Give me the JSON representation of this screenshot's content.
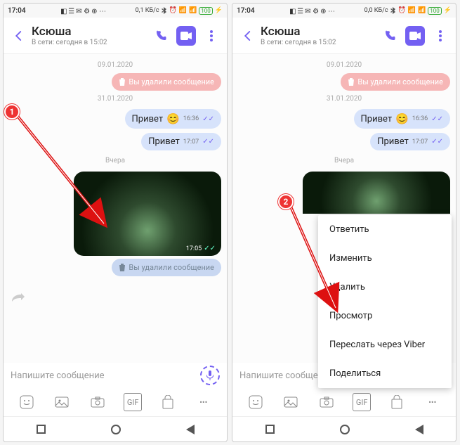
{
  "step1": {
    "badge": "1"
  },
  "step2": {
    "badge": "2"
  },
  "status": {
    "time": "17:04",
    "time2": "17:04",
    "net1": "0,1 КБ/с",
    "net2": "0,0 КБ/с",
    "battery": "100"
  },
  "header": {
    "title": "Ксюша",
    "subtitle": "В сети: сегодня в 15:02"
  },
  "dates": {
    "d1": "09.01.2020",
    "d2": "31.01.2020",
    "d3": "Вчера"
  },
  "messages": {
    "deleted": "Вы удалили сообщение",
    "m1_text": "Привет",
    "m1_time": "16:36",
    "m2_text": "Привет",
    "m2_time": "17:07",
    "img_time": "17:05"
  },
  "input": {
    "placeholder": "Напишите сообщение"
  },
  "attach": {
    "gif": "GIF"
  },
  "menu": {
    "reply": "Ответить",
    "edit": "Изменить",
    "delete": "Удалить",
    "view": "Просмотр",
    "forward": "Переслать через Viber",
    "share": "Поделиться"
  }
}
